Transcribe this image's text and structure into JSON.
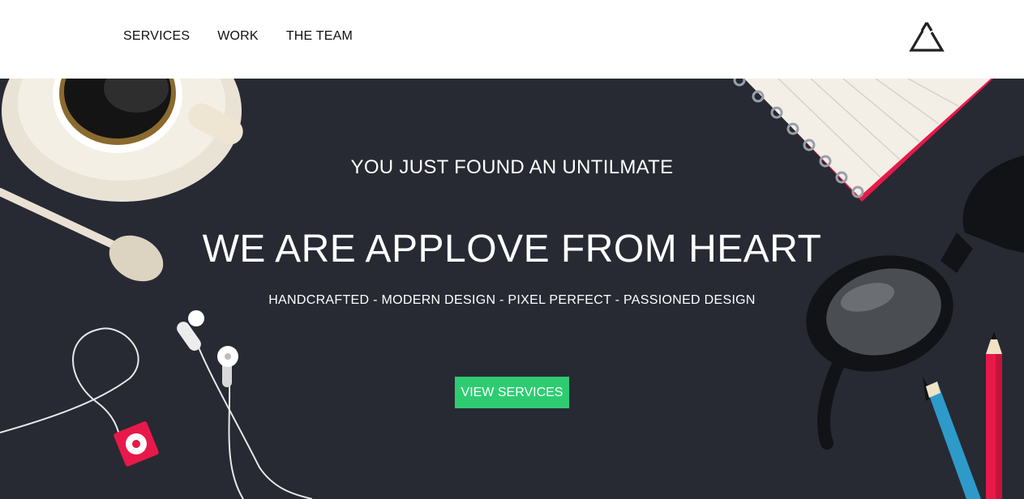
{
  "nav": {
    "items": [
      {
        "label": "SERVICES"
      },
      {
        "label": "WORK"
      },
      {
        "label": "THE TEAM"
      }
    ],
    "logo_icon": "triangle-logo-icon"
  },
  "hero": {
    "eyebrow": "YOU JUST FOUND AN UNTILMATE",
    "headline": "WE ARE APPLOVE FROM HEART",
    "tagline": "HANDCRAFTED - MODERN DESIGN - PIXEL PERFECT - PASSIONED DESIGN",
    "cta_label": "VIEW SERVICES",
    "illustrations": [
      "coffee-cup",
      "spoon",
      "earphones",
      "music-player",
      "notebook",
      "glasses",
      "pencils"
    ]
  },
  "colors": {
    "hero_bg": "#272a33",
    "cta": "#2ecc71",
    "accent_red": "#e8194a",
    "pencil_blue": "#2e9ac9"
  }
}
